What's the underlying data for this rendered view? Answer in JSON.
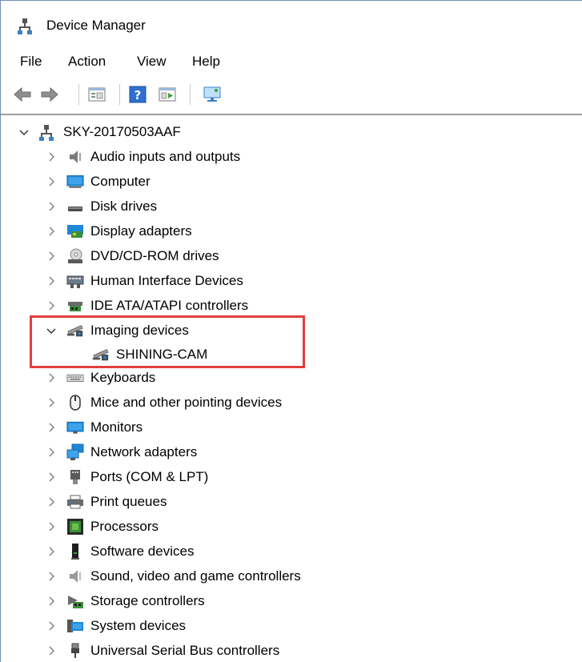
{
  "window": {
    "title": "Device Manager"
  },
  "menu": {
    "file": "File",
    "action": "Action",
    "view": "View",
    "help": "Help"
  },
  "toolbar": {
    "buttons": [
      "back-icon",
      "forward-icon",
      "properties-icon",
      "help-icon",
      "update-driver-icon",
      "monitor-icon"
    ]
  },
  "tree": {
    "root": {
      "label": "SKY-20170503AAF",
      "expanded": true
    },
    "categories": [
      {
        "label": "Audio inputs and outputs",
        "icon": "speaker-icon",
        "expanded": false
      },
      {
        "label": "Computer",
        "icon": "computer-icon",
        "expanded": false
      },
      {
        "label": "Disk drives",
        "icon": "disk-drive-icon",
        "expanded": false
      },
      {
        "label": "Display adapters",
        "icon": "display-adapter-icon",
        "expanded": false
      },
      {
        "label": "DVD/CD-ROM drives",
        "icon": "dvd-drive-icon",
        "expanded": false
      },
      {
        "label": "Human Interface Devices",
        "icon": "hid-icon",
        "expanded": false
      },
      {
        "label": "IDE ATA/ATAPI controllers",
        "icon": "ide-controller-icon",
        "expanded": false
      },
      {
        "label": "Imaging devices",
        "icon": "camera-icon",
        "expanded": true,
        "children": [
          {
            "label": "SHINING-CAM",
            "icon": "camera-icon"
          }
        ]
      },
      {
        "label": "Keyboards",
        "icon": "keyboard-icon",
        "expanded": false
      },
      {
        "label": "Mice and other pointing devices",
        "icon": "mouse-icon",
        "expanded": false
      },
      {
        "label": "Monitors",
        "icon": "monitor-icon",
        "expanded": false
      },
      {
        "label": "Network adapters",
        "icon": "network-icon",
        "expanded": false
      },
      {
        "label": "Ports (COM & LPT)",
        "icon": "port-icon",
        "expanded": false
      },
      {
        "label": "Print queues",
        "icon": "printer-icon",
        "expanded": false
      },
      {
        "label": "Processors",
        "icon": "processor-icon",
        "expanded": false
      },
      {
        "label": "Software devices",
        "icon": "software-device-icon",
        "expanded": false
      },
      {
        "label": "Sound, video and game controllers",
        "icon": "sound-icon",
        "expanded": false
      },
      {
        "label": "Storage controllers",
        "icon": "storage-icon",
        "expanded": false
      },
      {
        "label": "System devices",
        "icon": "system-devices-icon",
        "expanded": false
      },
      {
        "label": "Universal Serial Bus controllers",
        "icon": "usb-icon",
        "expanded": false
      }
    ]
  },
  "colors": {
    "highlight": "#e0403b",
    "accent_blue": "#1e88d6"
  }
}
